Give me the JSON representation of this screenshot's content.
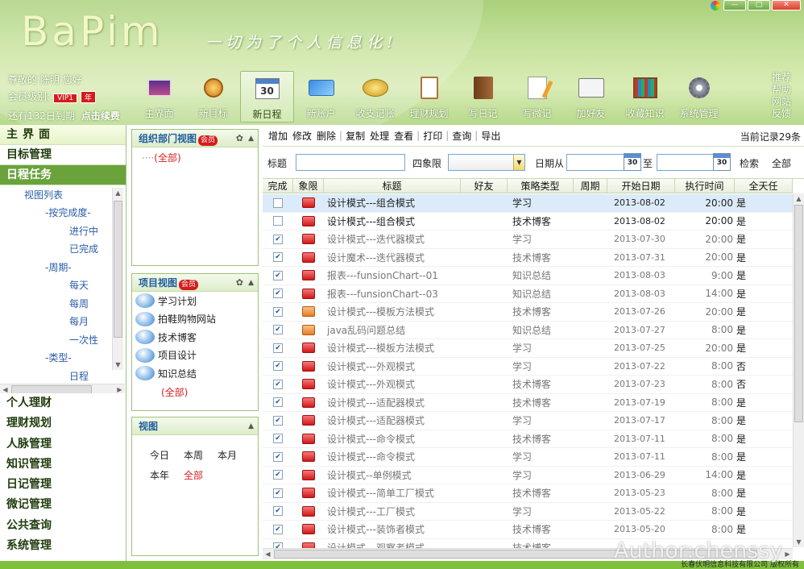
{
  "app": {
    "logo": "BaPim",
    "slogan": "一切为了个人信息化!"
  },
  "user": {
    "greeting": "尊敬的 陈明 您好",
    "level_label": "会员级别:",
    "vip": "VIP1",
    "year": "年",
    "expiry": "还有132日到期",
    "renew": "点击续费"
  },
  "nav": [
    {
      "label": "主界面",
      "icon": "monitor-icon"
    },
    {
      "label": "新目标",
      "icon": "medal-icon"
    },
    {
      "label": "新日程",
      "icon": "calendar-icon",
      "active": true
    },
    {
      "label": "新账户",
      "icon": "card-icon"
    },
    {
      "label": "收支记账",
      "icon": "coins-icon"
    },
    {
      "label": "理财规划",
      "icon": "clipboard-icon"
    },
    {
      "label": "写日记",
      "icon": "notebook-icon"
    },
    {
      "label": "写微记",
      "icon": "pencil-note-icon"
    },
    {
      "label": "加好友",
      "icon": "contact-card-icon"
    },
    {
      "label": "收藏知识",
      "icon": "bookshelf-icon"
    },
    {
      "label": "系统管理",
      "icon": "gear-icon"
    }
  ],
  "right_links": [
    "推荐",
    "帮助",
    "网站",
    "反馈"
  ],
  "left_menu": {
    "top": "主界面",
    "goals": "目标管理",
    "schedule": "日程任务",
    "tree": {
      "view_list": "视图列表",
      "by_progress": "-按完成度-",
      "in_progress": "进行中",
      "completed": "已完成",
      "by_period": "-周期-",
      "daily": "每天",
      "weekly": "每周",
      "monthly": "每月",
      "once": "一次性",
      "by_type": "-类型-",
      "schedule": "日程"
    },
    "lower": [
      "个人理财",
      "理财规划",
      "人脉管理",
      "知识管理",
      "日记管理",
      "微记管理",
      "公共查询",
      "系统管理"
    ]
  },
  "panels": {
    "org": {
      "title": "组织部门视图",
      "badge": "会员",
      "all": "(全部)"
    },
    "project": {
      "title": "项目视图",
      "badge": "会员",
      "items": [
        "学习计划",
        "拍鞋购物网站",
        "技术博客",
        "项目设计",
        "知识总结"
      ],
      "all": "(全部)"
    },
    "view": {
      "title": "视图",
      "today": "今日",
      "week": "本周",
      "month": "本月",
      "year": "本年",
      "all": "全部"
    }
  },
  "toolbar": {
    "buttons": [
      "增加",
      "修改",
      "删除",
      "复制",
      "处理",
      "查看",
      "打印",
      "查询",
      "导出"
    ],
    "record": "当前记录29条"
  },
  "filter": {
    "title": "标题",
    "quadrant": "四象限",
    "date_from": "日期从",
    "to": "至",
    "search": "检索",
    "all": "全部",
    "cal": "30"
  },
  "grid": {
    "headers": [
      "完成",
      "象限",
      "标题",
      "好友",
      "策略类型",
      "周期",
      "开始日期",
      "执行时间",
      "全天任"
    ],
    "rows": [
      {
        "done": false,
        "q": "r",
        "title": "设计模式---组合模式",
        "friend": "",
        "type": "学习",
        "period": "",
        "date": "2013-08-02",
        "time": "20:00",
        "allday": "是"
      },
      {
        "done": false,
        "q": "r",
        "title": "设计模式---组合模式",
        "friend": "",
        "type": "技术博客",
        "period": "",
        "date": "2013-08-02",
        "time": "20:00",
        "allday": "是"
      },
      {
        "done": true,
        "q": "r",
        "title": "设计模式---迭代器模式",
        "friend": "",
        "type": "学习",
        "period": "",
        "date": "2013-07-30",
        "time": "20:00",
        "allday": "是"
      },
      {
        "done": true,
        "q": "r",
        "title": "设计魔术---迭代器模式",
        "friend": "",
        "type": "技术博客",
        "period": "",
        "date": "2013-07-31",
        "time": "20:00",
        "allday": "是"
      },
      {
        "done": true,
        "q": "r",
        "title": "报表---funsionChart--01",
        "friend": "",
        "type": "知识总结",
        "period": "",
        "date": "2013-08-03",
        "time": "9:00",
        "allday": "是"
      },
      {
        "done": true,
        "q": "r",
        "title": "报表---funsionChart--03",
        "friend": "",
        "type": "知识总结",
        "period": "",
        "date": "2013-08-03",
        "time": "14:00",
        "allday": "是"
      },
      {
        "done": true,
        "q": "o",
        "title": "设计模式---模板方法模式",
        "friend": "",
        "type": "技术博客",
        "period": "",
        "date": "2013-07-26",
        "time": "20:00",
        "allday": "是"
      },
      {
        "done": true,
        "q": "o",
        "title": "java乱码问题总结",
        "friend": "",
        "type": "知识总结",
        "period": "",
        "date": "2013-07-27",
        "time": "8:00",
        "allday": "是"
      },
      {
        "done": true,
        "q": "r",
        "title": "设计模式---模板方法模式",
        "friend": "",
        "type": "学习",
        "period": "",
        "date": "2013-07-25",
        "time": "20:00",
        "allday": "是"
      },
      {
        "done": true,
        "q": "r",
        "title": "设计模式---外观模式",
        "friend": "",
        "type": "学习",
        "period": "",
        "date": "2013-07-22",
        "time": "8:00",
        "allday": "否"
      },
      {
        "done": true,
        "q": "r",
        "title": "设计模式---外观模式",
        "friend": "",
        "type": "技术博客",
        "period": "",
        "date": "2013-07-23",
        "time": "8:00",
        "allday": "否"
      },
      {
        "done": true,
        "q": "r",
        "title": "设计模式---适配器模式",
        "friend": "",
        "type": "技术博客",
        "period": "",
        "date": "2013-07-19",
        "time": "8:00",
        "allday": "是"
      },
      {
        "done": true,
        "q": "r",
        "title": "设计模式---适配器模式",
        "friend": "",
        "type": "学习",
        "period": "",
        "date": "2013-07-17",
        "time": "8:00",
        "allday": "是"
      },
      {
        "done": true,
        "q": "r",
        "title": "设计模式---命令模式",
        "friend": "",
        "type": "技术博客",
        "period": "",
        "date": "2013-07-11",
        "time": "8:00",
        "allday": "是"
      },
      {
        "done": true,
        "q": "r",
        "title": "设计模式---命令模式",
        "friend": "",
        "type": "学习",
        "period": "",
        "date": "2013-07-11",
        "time": "8:00",
        "allday": "是"
      },
      {
        "done": true,
        "q": "r",
        "title": "设计模式--单例模式",
        "friend": "",
        "type": "学习",
        "period": "",
        "date": "2013-06-29",
        "time": "14:00",
        "allday": "是"
      },
      {
        "done": true,
        "q": "r",
        "title": "设计模式---简单工厂模式",
        "friend": "",
        "type": "技术博客",
        "period": "",
        "date": "2013-05-23",
        "time": "8:00",
        "allday": "是"
      },
      {
        "done": true,
        "q": "r",
        "title": "设计模式---工厂模式",
        "friend": "",
        "type": "学习",
        "period": "",
        "date": "2013-05-22",
        "time": "8:00",
        "allday": "是"
      },
      {
        "done": true,
        "q": "r",
        "title": "设计模式---装饰者模式",
        "friend": "",
        "type": "技术博客",
        "period": "",
        "date": "2013-05-20",
        "time": "8:00",
        "allday": "是"
      },
      {
        "done": true,
        "q": "r",
        "title": "设计模式---观察者模式",
        "friend": "",
        "type": "技术博客",
        "period": "",
        "date": "",
        "time": "",
        "allday": ""
      }
    ]
  },
  "footer": {
    "author": "Author:chenssy",
    "copyright": "长春伏明信息科技有限公司 版权所有"
  },
  "colors": {
    "accent": "#6aa33c",
    "header": "#b7d98c",
    "badge": "#d51c1c",
    "link": "#2a5da8"
  }
}
